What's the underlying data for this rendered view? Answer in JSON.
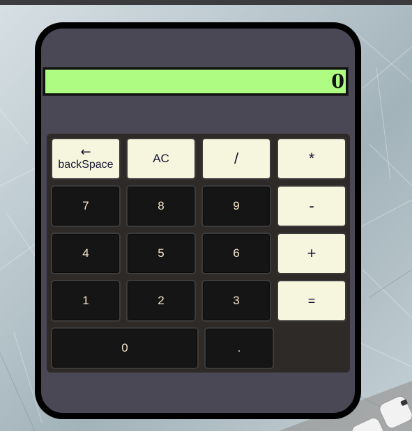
{
  "display": {
    "value": "0"
  },
  "keys": {
    "backspace": {
      "icon": "left-arrow-icon",
      "glyph": "←",
      "label": "backSpace"
    },
    "clear": "AC",
    "divide": "/",
    "multiply": "*",
    "seven": "7",
    "eight": "8",
    "nine": "9",
    "minus": "-",
    "four": "4",
    "five": "5",
    "six": "6",
    "plus": "+",
    "one": "1",
    "two": "2",
    "three": "3",
    "equals": "=",
    "zero": "0",
    "decimal": "."
  },
  "colors": {
    "display_bg": "#aefc81",
    "body_bg": "#4a4855",
    "keypad_bg": "#2e2a28",
    "number_key_bg": "#151515",
    "number_key_text": "#f4e6cc",
    "operator_key_bg": "#f6f6df",
    "operator_key_text": "#141432"
  }
}
